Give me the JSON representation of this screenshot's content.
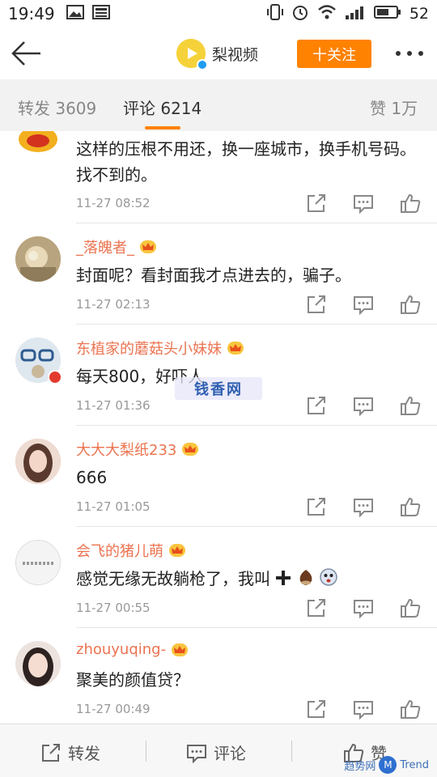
{
  "status_bar": {
    "time": "19:49",
    "battery": "52"
  },
  "header": {
    "channel_name": "梨视频",
    "follow_label": "十关注"
  },
  "tabs": [
    {
      "label": "转发 3609"
    },
    {
      "label": "评论 6214"
    },
    {
      "label": "赞 1万"
    }
  ],
  "comments": [
    {
      "username": "",
      "text": "这样的压根不用还，换一座城市，换手机号码。找不到的。",
      "time": "11-27 08:52",
      "has_crown": false
    },
    {
      "username": "_落魄者_",
      "text": "封面呢？看封面我才点进去的，骗子。",
      "time": "11-27 02:13",
      "has_crown": true
    },
    {
      "username": "东植家的蘑菇头小妹妹",
      "text": "每天800，好吓人",
      "time": "11-27 01:36",
      "has_crown": true
    },
    {
      "username": "大大大梨纸233",
      "text": "666",
      "time": "11-27 01:05",
      "has_crown": true
    },
    {
      "username": "会飞的猪儿萌",
      "text": "感觉无缘无故躺枪了，我叫",
      "time": "11-27 00:55",
      "has_crown": true
    },
    {
      "username": "zhouyuqing-",
      "text": "聚美的颜值贷？",
      "time": "11-27 00:49",
      "has_crown": true
    }
  ],
  "overlay_stamp": "钱香网",
  "bottom_bar": {
    "repost": "转发",
    "comment": "评论",
    "like": "赞"
  },
  "watermark": {
    "text": "趋势网",
    "brand": "Trend",
    "logo": "M"
  },
  "colors": {
    "accent": "#ff8200",
    "username": "#eb7350",
    "timestamp": "#999999"
  }
}
